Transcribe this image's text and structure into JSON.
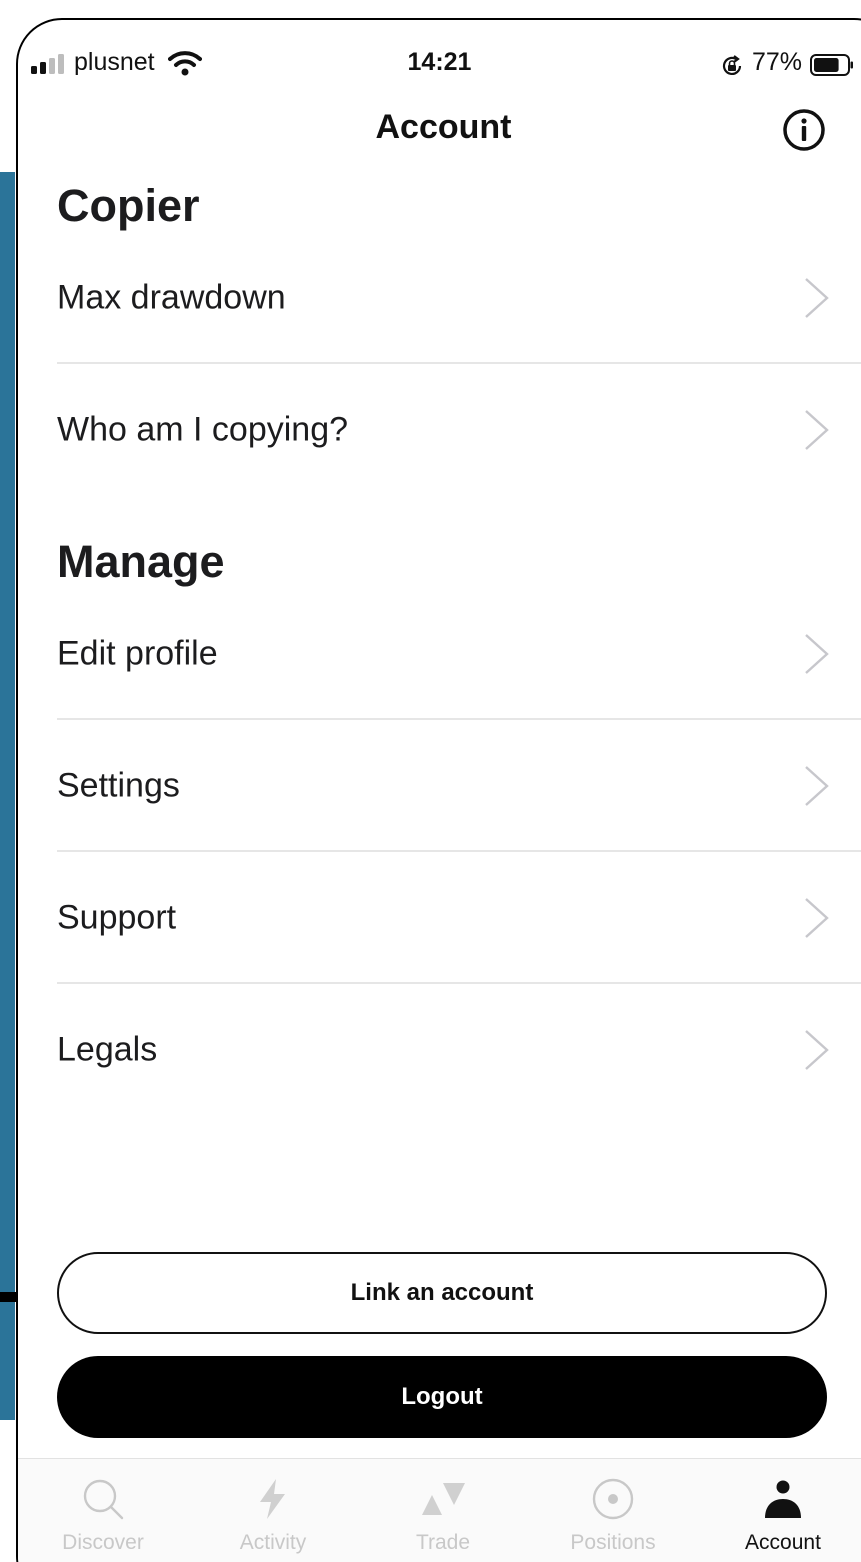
{
  "status_bar": {
    "carrier": "plusnet",
    "time": "14:21",
    "battery_percent": "77%",
    "battery_level": 0.77,
    "icons": [
      "signal-icon",
      "wifi-icon",
      "rotation-lock-icon",
      "battery-icon"
    ]
  },
  "nav": {
    "title": "Account",
    "info_icon": "info-icon"
  },
  "sections": {
    "copier": {
      "title": "Copier",
      "items": [
        {
          "label": "Max drawdown"
        },
        {
          "label": "Who am I copying?"
        }
      ]
    },
    "manage": {
      "title": "Manage",
      "items": [
        {
          "label": "Edit profile"
        },
        {
          "label": "Settings"
        },
        {
          "label": "Support"
        },
        {
          "label": "Legals"
        }
      ]
    }
  },
  "buttons": {
    "link_account": "Link an account",
    "logout": "Logout"
  },
  "tabbar": {
    "active": "account",
    "tabs": [
      {
        "label": "Discover",
        "icon": "search-icon"
      },
      {
        "label": "Activity",
        "icon": "lightning-icon"
      },
      {
        "label": "Trade",
        "icon": "trade-arrows-icon"
      },
      {
        "label": "Positions",
        "icon": "target-icon"
      },
      {
        "label": "Account",
        "icon": "person-icon"
      }
    ]
  },
  "colors": {
    "accent_strip": "#2b7499",
    "text_primary": "#1c1c1e",
    "tab_inactive": "#c8c8c8",
    "divider": "#e6e6e6"
  }
}
